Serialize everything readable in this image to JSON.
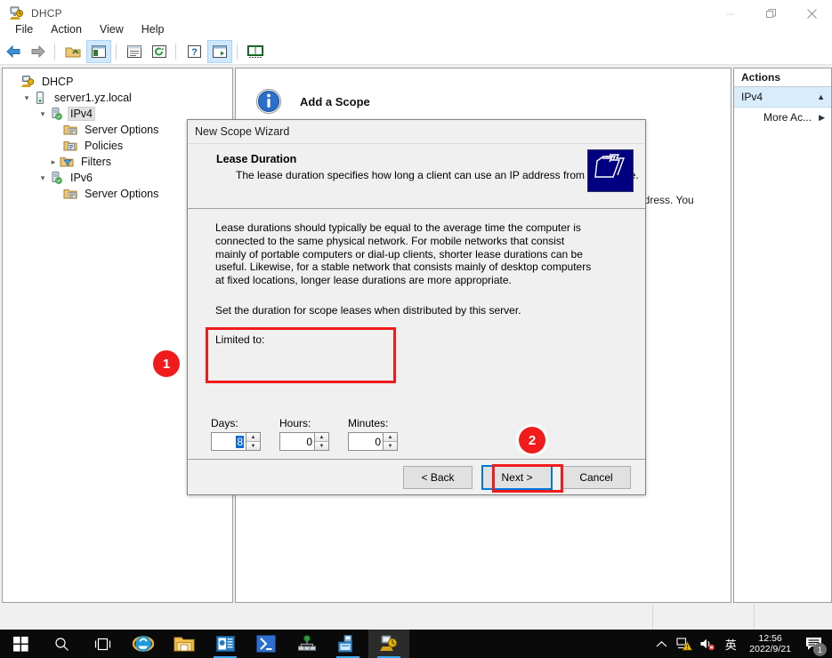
{
  "window": {
    "title": "DHCP",
    "icon": "dhcp-server-icon",
    "controls": {
      "minimize": "minimize-icon",
      "maximize": "restore-icon",
      "close": "close-icon"
    }
  },
  "menubar": {
    "items": [
      "File",
      "Action",
      "View",
      "Help"
    ]
  },
  "toolbar": {
    "buttons": [
      {
        "name": "back-icon",
        "selected": false
      },
      {
        "name": "forward-icon",
        "selected": false
      },
      {
        "name": "up-one-level-icon",
        "selected": false
      },
      {
        "name": "show-hide-console-tree-icon",
        "selected": true
      },
      {
        "name": "properties-icon",
        "selected": false
      },
      {
        "name": "refresh-icon",
        "selected": false
      },
      {
        "name": "help-icon",
        "selected": false
      },
      {
        "name": "show-hide-action-pane-icon",
        "selected": true
      },
      {
        "name": "export-list-icon",
        "selected": false
      }
    ]
  },
  "tree": {
    "nodes": [
      {
        "label": "DHCP",
        "indent": 0,
        "twisty": "",
        "icon": "dhcp-root-icon",
        "selected": false
      },
      {
        "label": "server1.yz.local",
        "indent": 1,
        "twisty": "v",
        "icon": "server-icon",
        "selected": false
      },
      {
        "label": "IPv4",
        "indent": 2,
        "twisty": "v",
        "icon": "ipv4-icon",
        "selected": true
      },
      {
        "label": "Server Options",
        "indent": 3,
        "twisty": "",
        "icon": "folder-options-icon",
        "selected": false
      },
      {
        "label": "Policies",
        "indent": 3,
        "twisty": "",
        "icon": "folder-policies-icon",
        "selected": false
      },
      {
        "label": "Filters",
        "indent": 3,
        "twisty": ">",
        "icon": "folder-filters-icon",
        "selected": false
      },
      {
        "label": "IPv6",
        "indent": 2,
        "twisty": "v",
        "icon": "ipv6-icon",
        "selected": false
      },
      {
        "label": "Server Options",
        "indent": 3,
        "twisty": "",
        "icon": "folder-options-icon",
        "selected": false
      }
    ]
  },
  "center": {
    "scope_header_title": "Add a Scope",
    "scope_header_icon": "info-icon",
    "background_text_fragment": "ldress. You"
  },
  "actions": {
    "title": "Actions",
    "group": {
      "label": "IPv4",
      "caret": "collapse-caret-icon"
    },
    "items": [
      {
        "label": "More Ac...",
        "arrow": "submenu-arrow-icon"
      }
    ]
  },
  "wizard": {
    "titlebar": "New Scope Wizard",
    "heading": "Lease Duration",
    "subheading": "The lease duration specifies how long a client can use an IP address from this scope.",
    "header_icon": "folders-stack-icon",
    "paragraph1": "Lease durations should typically be equal to the average time the computer is connected to the same physical network. For mobile networks that consist mainly of portable computers or dial-up clients, shorter lease durations can be useful. Likewise, for a stable network that consists mainly of desktop computers at fixed locations, longer lease durations are more appropriate.",
    "paragraph2": "Set the duration for scope leases when distributed by this server.",
    "limited_label": "Limited to:",
    "fields": [
      {
        "label": "Days:",
        "value": "8",
        "selected": true,
        "name": "days-stepper"
      },
      {
        "label": "Hours:",
        "value": "0",
        "selected": false,
        "name": "hours-stepper"
      },
      {
        "label": "Minutes:",
        "value": "0",
        "selected": false,
        "name": "minutes-stepper"
      }
    ],
    "buttons": {
      "back": "< Back",
      "next": "Next >",
      "cancel": "Cancel"
    }
  },
  "annotations": {
    "badge1": "1",
    "badge2": "2",
    "highlight_color": "#f21b1b",
    "focus_color": "#0078d7"
  },
  "taskbar": {
    "items": [
      {
        "name": "start-button",
        "icon": "windows-logo-icon"
      },
      {
        "name": "search-button",
        "icon": "search-icon"
      },
      {
        "name": "task-view-button",
        "icon": "task-view-icon"
      },
      {
        "name": "internet-explorer-button",
        "icon": "internet-explorer-icon"
      },
      {
        "name": "file-explorer-button",
        "icon": "file-explorer-icon"
      },
      {
        "name": "server-manager-button",
        "icon": "server-manager-icon"
      },
      {
        "name": "powershell-button",
        "icon": "powershell-icon"
      },
      {
        "name": "network-tool-button",
        "icon": "network-sitemap-icon"
      },
      {
        "name": "computer-management-button",
        "icon": "computer-management-icon"
      },
      {
        "name": "dhcp-button",
        "icon": "dhcp-server-icon"
      }
    ],
    "tray": {
      "show_hidden": "chevron-up-icon",
      "network": "network-warning-icon",
      "volume": "volume-muted-icon",
      "ime": "英",
      "time": "12:56",
      "date": "2022/9/21",
      "notifications_icon": "action-center-icon",
      "notifications_count": "1"
    }
  }
}
